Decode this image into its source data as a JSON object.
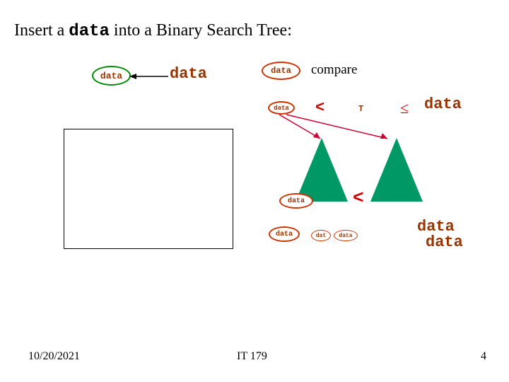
{
  "title": {
    "prefix": "Insert a ",
    "mono": "data",
    "suffix": " into a Binary Search Tree:"
  },
  "nodes": {
    "new_data_oval": "data",
    "big_data_label": "data",
    "root_oval": "data",
    "compare_label": "compare",
    "small_data_oval": "data",
    "lt_symbol": "<",
    "t_label": "T",
    "leq_symbol": "≤",
    "right_data_big": "data",
    "mid_data_oval": "data",
    "mid_lt": "<",
    "bottom_oval1": "data",
    "bottom_small1": "dat",
    "bottom_small2": "data",
    "right_stack1": "data",
    "right_stack2": "data"
  },
  "footer": {
    "date": "10/20/2021",
    "center": "IT 179",
    "page": "4"
  }
}
